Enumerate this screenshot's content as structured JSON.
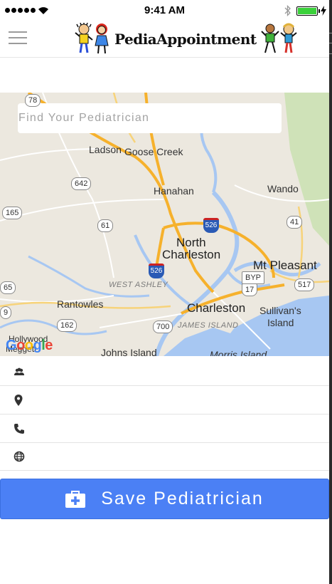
{
  "status_bar": {
    "carrier_signal": "●●●●●",
    "time": "9:41 AM",
    "battery_level": 1.0
  },
  "app": {
    "title": "PediaAppointment"
  },
  "search": {
    "placeholder": "Find Your Pediatrician",
    "value": ""
  },
  "map": {
    "places": {
      "ladson": "Ladson",
      "goose_creek": "Goose Creek",
      "hanahan": "Hanahan",
      "wando": "Wando",
      "north_charleston_1": "North",
      "north_charleston_2": "Charleston",
      "mt_pleasant": "Mt Pleasant",
      "west_ashley": "WEST ASHLEY",
      "rantowles": "Rantowles",
      "charleston": "Charleston",
      "sullivans_1": "Sullivan's",
      "sullivans_2": "Island",
      "james_island": "JAMES ISLAND",
      "johns_island": "Johns Island",
      "hollywood": "Hollywood",
      "meggett": "Meggett",
      "morris_island": "Morris Island"
    },
    "routes": {
      "r78": "78",
      "r642": "642",
      "r165": "165",
      "r61": "61",
      "r41": "41",
      "r526a": "526",
      "r526b": "526",
      "r17": "17",
      "r517": "517",
      "r162": "162",
      "r700": "700",
      "r65": "65",
      "r9": "9",
      "byp": "BYP"
    },
    "attribution": [
      "G",
      "o",
      "o",
      "g",
      "l",
      "e"
    ]
  },
  "details": {
    "name": "",
    "address": "",
    "phone": "",
    "website": ""
  },
  "save_button": {
    "label": "Save Pediatrician"
  },
  "colors": {
    "accent": "#4b80f5",
    "highway": "#f6b12c",
    "water": "#a7c7f2",
    "land": "#ece8df"
  }
}
